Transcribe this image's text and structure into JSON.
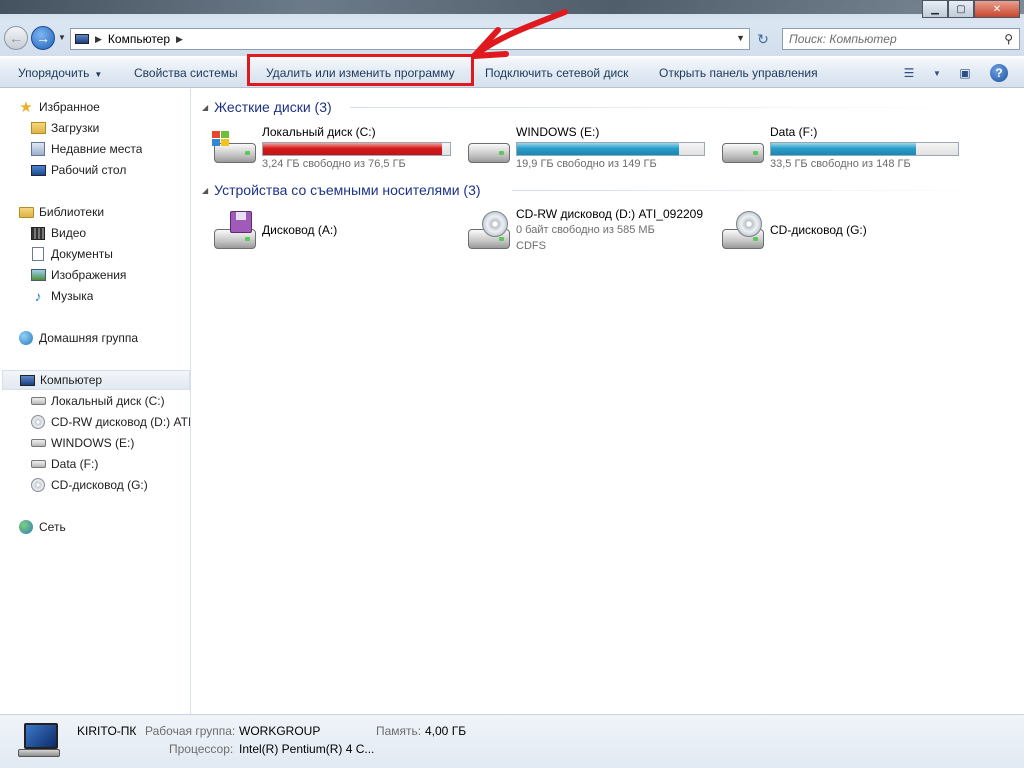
{
  "address": {
    "crumbs": [
      "Компьютер"
    ],
    "search_placeholder": "Поиск: Компьютер"
  },
  "toolbar": {
    "organize": "Упорядочить",
    "system_properties": "Свойства системы",
    "uninstall": "Удалить или изменить программу",
    "map_drive": "Подключить сетевой диск",
    "control_panel": "Открыть панель управления"
  },
  "sidebar": {
    "favorites": "Избранное",
    "downloads": "Загрузки",
    "recent": "Недавние места",
    "desktop": "Рабочий стол",
    "libraries": "Библиотеки",
    "video": "Видео",
    "documents": "Документы",
    "images": "Изображения",
    "music": "Музыка",
    "homegroup": "Домашняя группа",
    "computer": "Компьютер",
    "drive_c": "Локальный диск (C:)",
    "drive_d": "CD-RW дисковод (D:) ATI_",
    "drive_e": "WINDOWS (E:)",
    "drive_f": "Data (F:)",
    "drive_g": "CD-дисковод (G:)",
    "network": "Сеть"
  },
  "groups": {
    "hdd_title": "Жесткие диски (3)",
    "removable_title": "Устройства со съемными носителями (3)"
  },
  "hard_drives": [
    {
      "name": "Локальный диск (C:)",
      "free": "3,24 ГБ свободно из 76,5 ГБ",
      "used_fraction": 0.958,
      "color": "#d31a1a"
    },
    {
      "name": "WINDOWS (E:)",
      "free": "19,9 ГБ свободно из 149 ГБ",
      "used_fraction": 0.866,
      "color": "#2a9dc8"
    },
    {
      "name": "Data (F:)",
      "free": "33,5 ГБ свободно из 148 ГБ",
      "used_fraction": 0.774,
      "color": "#2a9dc8"
    }
  ],
  "removable": [
    {
      "name": "Дисковод (A:)"
    },
    {
      "name": "CD-RW дисковод (D:) ATI_092209",
      "free": "0 байт свободно из 585 МБ",
      "fs": "CDFS"
    },
    {
      "name": "CD-дисковод (G:)"
    }
  ],
  "details": {
    "computer_name": "KIRITO-ПК",
    "workgroup_label": "Рабочая группа:",
    "workgroup_value": "WORKGROUP",
    "memory_label": "Память:",
    "memory_value": "4,00 ГБ",
    "cpu_label": "Процессор:",
    "cpu_value": "Intel(R) Pentium(R) 4 C..."
  },
  "colors": {
    "highlight_box": "#e0191e",
    "accent_text": "#1e3287"
  }
}
